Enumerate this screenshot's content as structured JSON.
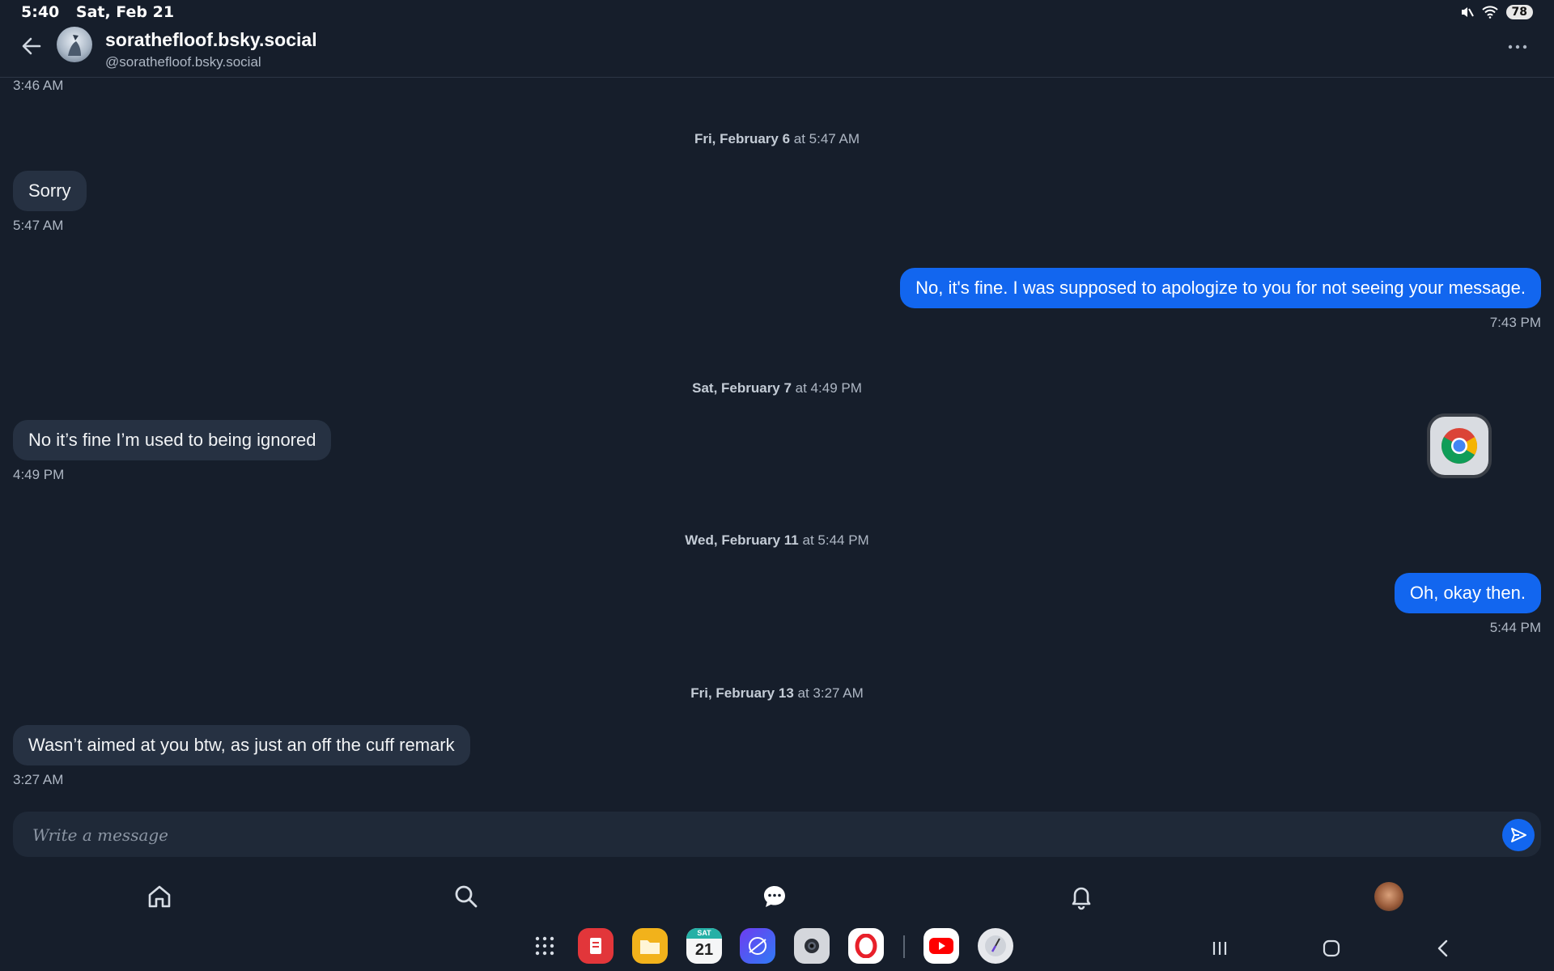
{
  "status_bar": {
    "time": "5:40",
    "date": "Sat, Feb 21",
    "battery": "78"
  },
  "header": {
    "display_name": "sorathefloof.bsky.social",
    "handle": "@sorathefloof.bsky.social"
  },
  "conversation": {
    "top_timestamp": "3:46 AM",
    "groups": [
      {
        "date_bold": "Fri, February 6",
        "date_time": " at 5:47 AM",
        "messages": [
          {
            "direction": "incoming",
            "text": "Sorry",
            "time": "5:47 AM"
          },
          {
            "direction": "outgoing",
            "text": "No, it's fine. I was supposed to apologize to you for not seeing your message.",
            "time": "7:43 PM"
          }
        ]
      },
      {
        "date_bold": "Sat, February 7",
        "date_time": " at 4:49 PM",
        "messages": [
          {
            "direction": "incoming",
            "text": "No it’s fine I’m used to being ignored",
            "time": "4:49 PM"
          }
        ]
      },
      {
        "date_bold": "Wed, February 11",
        "date_time": " at 5:44 PM",
        "messages": [
          {
            "direction": "outgoing",
            "text": "Oh, okay then.",
            "time": "5:44 PM"
          }
        ]
      },
      {
        "date_bold": "Fri, February 13",
        "date_time": " at 3:27 AM",
        "messages": [
          {
            "direction": "incoming",
            "text": "Wasn’t aimed at you btw, as just an off the cuff remark",
            "time": "3:27 AM"
          }
        ]
      }
    ]
  },
  "composer": {
    "placeholder": "Write a message",
    "value": ""
  },
  "bottom_nav": [
    "home-icon",
    "search-icon",
    "chat-icon",
    "bell-icon",
    "profile-avatar"
  ],
  "dock": {
    "calendar_day_label": "SAT",
    "calendar_day_number": "21",
    "apps": [
      "apps-grid-icon",
      "notes-app-icon",
      "files-app-icon",
      "calendar-app-icon",
      "browser-app-icon",
      "camera-app-icon",
      "opera-app-icon",
      "youtube-app-icon",
      "clock-app-icon"
    ],
    "system_buttons": [
      "recents-button",
      "home-button",
      "back-button"
    ]
  },
  "floating_bubble": "chrome-icon",
  "colors": {
    "background": "#161e2b",
    "incoming_bubble": "#263142",
    "outgoing_bubble": "#1266ef"
  }
}
